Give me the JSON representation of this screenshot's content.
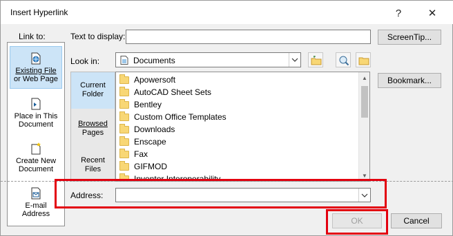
{
  "window": {
    "title": "Insert Hyperlink",
    "help_glyph": "?",
    "close_glyph": "✕"
  },
  "link_to": {
    "label": "Link to:",
    "items": [
      {
        "line1": "Existing File",
        "line2": "or Web Page",
        "icon": "web-page-icon",
        "selected": true
      },
      {
        "line1": "Place in This",
        "line2": "Document",
        "icon": "document-place-icon",
        "selected": false
      },
      {
        "line1": "Create New",
        "line2": "Document",
        "icon": "new-document-icon",
        "selected": false
      },
      {
        "line1": "E-mail",
        "line2": "Address",
        "icon": "email-icon",
        "selected": false
      }
    ]
  },
  "text_to_display": {
    "label": "Text to display:",
    "value": ""
  },
  "screentip_button": "ScreenTip...",
  "look_in": {
    "label": "Look in:",
    "value": "Documents"
  },
  "bookmark_button": "Bookmark...",
  "place_bar": [
    {
      "line1": "Current",
      "line2": "Folder",
      "selected": true
    },
    {
      "line1": "Browsed",
      "line2": "Pages",
      "selected": false
    },
    {
      "line1": "Recent",
      "line2": "Files",
      "selected": false
    }
  ],
  "files": [
    "Apowersoft",
    "AutoCAD Sheet Sets",
    "Bentley",
    "Custom Office Templates",
    "Downloads",
    "Enscape",
    "Fax",
    "GIFMOD",
    "Inventor Interoperability"
  ],
  "address": {
    "label": "Address:",
    "value": ""
  },
  "ok_button": "OK",
  "cancel_button": "Cancel",
  "colors": {
    "highlight_red": "#e3000f",
    "selection_blue": "#cce4f7"
  }
}
